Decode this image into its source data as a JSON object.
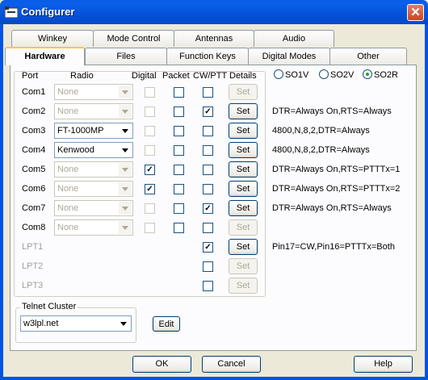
{
  "window": {
    "title": "Configurer",
    "close_glyph": "✕"
  },
  "tabs_back": [
    "Winkey",
    "Mode Control",
    "Antennas",
    "Audio"
  ],
  "tabs_front": [
    "Hardware",
    "Files",
    "Function Keys",
    "Digital Modes",
    "Other"
  ],
  "active_tab": "Hardware",
  "headers": {
    "port": "Port",
    "radio": "Radio",
    "digital": "Digital",
    "packet": "Packet",
    "cwptt": "CW/PTT",
    "details": "Details"
  },
  "so_radio": {
    "options": [
      "SO1V",
      "SO2V",
      "SO2R"
    ],
    "selected": "SO2R"
  },
  "rows": [
    {
      "port": "Com1",
      "radio": "None",
      "radio_enabled": false,
      "digital": false,
      "digital_enabled": false,
      "packet": false,
      "packet_enabled": true,
      "cwptt": false,
      "cwptt_enabled": true,
      "set_enabled": false,
      "set_label": "Set",
      "details": ""
    },
    {
      "port": "Com2",
      "radio": "None",
      "radio_enabled": false,
      "digital": false,
      "digital_enabled": false,
      "packet": false,
      "packet_enabled": true,
      "cwptt": true,
      "cwptt_enabled": true,
      "set_enabled": true,
      "set_label": "Set",
      "details": "DTR=Always On,RTS=Always"
    },
    {
      "port": "Com3",
      "radio": "FT-1000MP",
      "radio_enabled": true,
      "digital": false,
      "digital_enabled": false,
      "packet": false,
      "packet_enabled": true,
      "cwptt": false,
      "cwptt_enabled": true,
      "set_enabled": true,
      "set_label": "Set",
      "details": "4800,N,8,2,DTR=Always"
    },
    {
      "port": "Com4",
      "radio": "Kenwood",
      "radio_enabled": true,
      "digital": false,
      "digital_enabled": false,
      "packet": false,
      "packet_enabled": true,
      "cwptt": false,
      "cwptt_enabled": true,
      "set_enabled": true,
      "set_label": "Set",
      "details": "4800,N,8,2,DTR=Always"
    },
    {
      "port": "Com5",
      "radio": "None",
      "radio_enabled": false,
      "digital": true,
      "digital_enabled": true,
      "packet": false,
      "packet_enabled": true,
      "cwptt": false,
      "cwptt_enabled": true,
      "set_enabled": true,
      "set_label": "Set",
      "details": "DTR=Always On,RTS=PTTTx=1"
    },
    {
      "port": "Com6",
      "radio": "None",
      "radio_enabled": false,
      "digital": true,
      "digital_enabled": true,
      "packet": false,
      "packet_enabled": true,
      "cwptt": false,
      "cwptt_enabled": true,
      "set_enabled": true,
      "set_label": "Set",
      "details": "DTR=Always On,RTS=PTTTx=2"
    },
    {
      "port": "Com7",
      "radio": "None",
      "radio_enabled": false,
      "digital": false,
      "digital_enabled": false,
      "packet": false,
      "packet_enabled": true,
      "cwptt": true,
      "cwptt_enabled": true,
      "set_enabled": true,
      "set_label": "Set",
      "details": "DTR=Always On,RTS=Always"
    },
    {
      "port": "Com8",
      "radio": "None",
      "radio_enabled": false,
      "digital": false,
      "digital_enabled": false,
      "packet": false,
      "packet_enabled": true,
      "cwptt": false,
      "cwptt_enabled": true,
      "set_enabled": false,
      "set_label": "Set",
      "details": ""
    },
    {
      "port": "LPT1",
      "radio": null,
      "digital": null,
      "packet": null,
      "cwptt": true,
      "cwptt_enabled": true,
      "set_enabled": true,
      "set_label": "Set",
      "details": "Pin17=CW,Pin16=PTTTx=Both"
    },
    {
      "port": "LPT2",
      "radio": null,
      "digital": null,
      "packet": null,
      "cwptt": false,
      "cwptt_enabled": true,
      "set_enabled": false,
      "set_label": "Set",
      "details": ""
    },
    {
      "port": "LPT3",
      "radio": null,
      "digital": null,
      "packet": null,
      "cwptt": false,
      "cwptt_enabled": true,
      "set_enabled": false,
      "set_label": "Set",
      "details": ""
    }
  ],
  "telnet": {
    "label": "Telnet Cluster",
    "value": "w3lpl.net",
    "edit_label": "Edit"
  },
  "buttons": {
    "ok": "OK",
    "cancel": "Cancel",
    "help": "Help"
  },
  "check_glyph": "✓"
}
